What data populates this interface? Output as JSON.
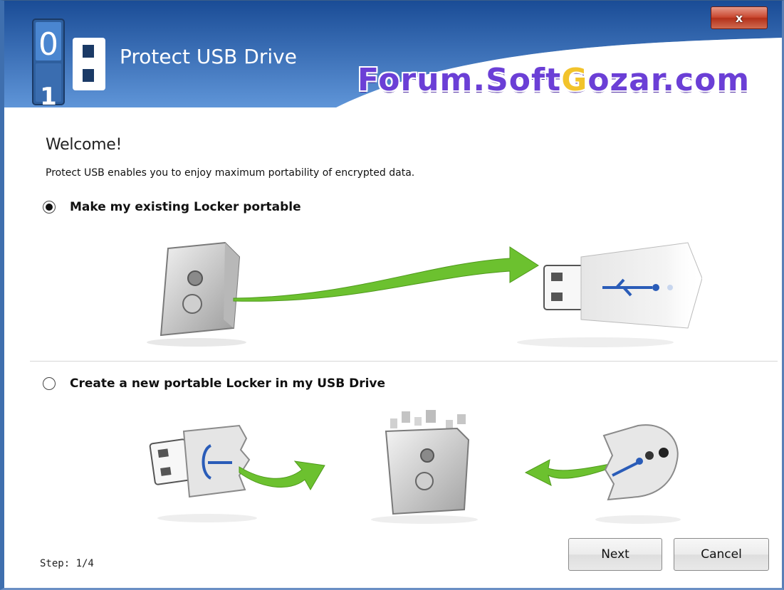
{
  "window": {
    "title": "Protect USB Drive",
    "close_label": "x",
    "logo_digits": {
      "top": "0",
      "bottom": "1"
    }
  },
  "watermark": {
    "pre": "Forum.Soft",
    "g": "G",
    "post": "ozar.com"
  },
  "main": {
    "heading": "Welcome!",
    "description": "Protect USB enables you to enjoy maximum portability of encrypted data.",
    "options": [
      {
        "label": "Make my existing Locker portable",
        "selected": true
      },
      {
        "label": "Create a new portable Locker in my USB Drive",
        "selected": false
      }
    ]
  },
  "footer": {
    "step_text": "Step: 1/4",
    "next_label": "Next",
    "cancel_label": "Cancel"
  },
  "colors": {
    "accent": "#3f78c4",
    "arrow_green": "#6cc12f",
    "watermark": "#6b3fd6",
    "usb_blue": "#2a5cb8"
  },
  "icons": [
    "close-icon",
    "app-logo-icon",
    "safe-icon",
    "usb-drive-icon",
    "arrow-icon"
  ]
}
